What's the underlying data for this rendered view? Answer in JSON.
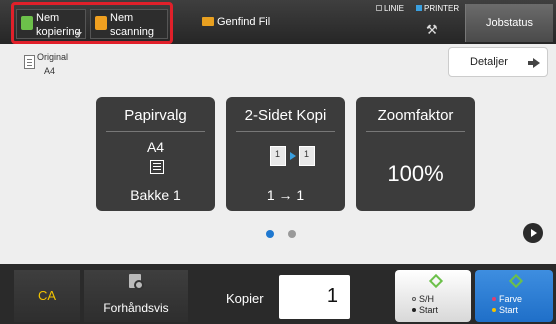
{
  "topbar": {
    "quick_copy": {
      "label_line1": "Nem",
      "label_line2": "kopiering",
      "icon": "copy-icon",
      "color": "#6cc04a"
    },
    "quick_scan": {
      "label_line1": "Nem",
      "label_line2": "scanning",
      "icon": "scan-icon",
      "color": "#f0a020"
    },
    "file_retrieval": {
      "label": "Genfind Fil",
      "icon": "folder-icon"
    },
    "status": {
      "line": "LINIE",
      "printer": "PRINTER"
    },
    "settings_icon": "wrench-icon",
    "job_status": "Jobstatus"
  },
  "original": {
    "label": "Original",
    "value": "A4",
    "icon": "document-icon"
  },
  "details_button": "Detaljer",
  "tiles": [
    {
      "title": "Papirvalg",
      "size": "A4",
      "tray": "Bakke 1"
    },
    {
      "title": "2-Sidet Kopi",
      "mode": "1 → 1"
    },
    {
      "title": "Zoomfaktor",
      "value": "100%"
    }
  ],
  "pagination": {
    "pages": 2,
    "current": 1
  },
  "bottom": {
    "ca": "CA",
    "preview": "Forhåndsvis",
    "copies_label": "Kopier",
    "copies_value": "1",
    "bw_start": {
      "line1": "S/H",
      "line2": "Start"
    },
    "color_start": {
      "line1": "Farve",
      "line2": "Start"
    }
  },
  "colors": {
    "accent_blue": "#1f6fc8",
    "highlight": "#e0202a",
    "start_green": "#6cc04a",
    "ca_yellow": "#f2c300"
  }
}
